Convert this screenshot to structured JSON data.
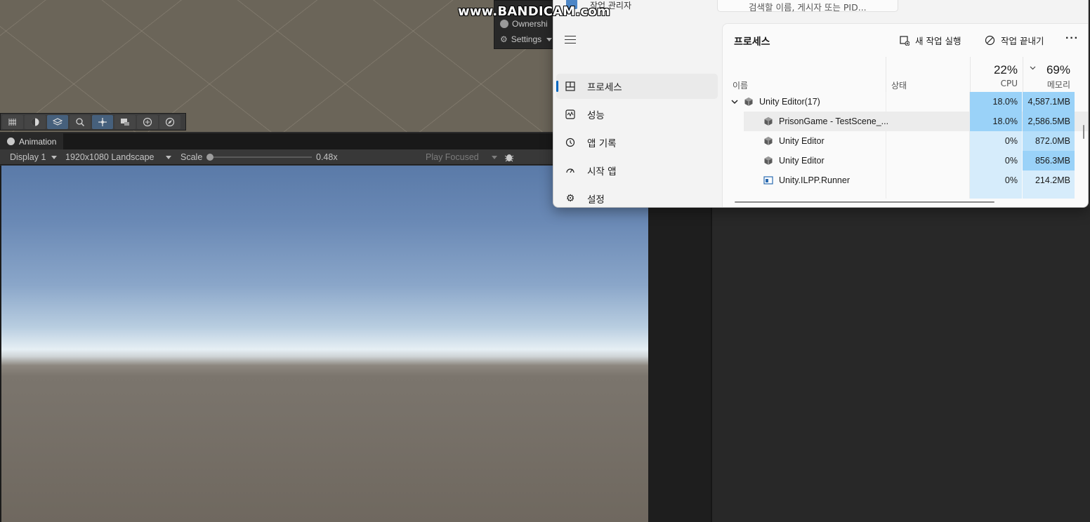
{
  "watermark": "www.BANDICAM.com",
  "netcode_panel": {
    "ownership": "Ownershi",
    "settings": "Settings"
  },
  "scene_toolbar": {
    "tools": [
      "grid-snap-icon",
      "shading-icon",
      "layers-icon",
      "search-icon",
      "move-tool-icon",
      "gizmo-icon",
      "audio-icon",
      "navigate-icon"
    ]
  },
  "game_view": {
    "tab_label": "Animation",
    "display": "Display 1",
    "resolution": "1920x1080 Landscape",
    "scale_label": "Scale",
    "scale_value": "0.48x",
    "play_mode": "Play Focused"
  },
  "task_manager": {
    "title": "작업 관리자",
    "search_placeholder": "검색할 이름, 게시자 또는 PID...",
    "nav": [
      {
        "label": "프로세스",
        "icon": "processes-icon",
        "selected": true
      },
      {
        "label": "성능",
        "icon": "performance-icon",
        "selected": false
      },
      {
        "label": "앱 기록",
        "icon": "history-icon",
        "selected": false
      },
      {
        "label": "시작 앱",
        "icon": "startup-icon",
        "selected": false
      },
      {
        "label": "설정",
        "icon": "settings-icon",
        "selected": false
      }
    ],
    "content_title": "프로세스",
    "actions": {
      "new_task": "새 작업 실행",
      "end_task": "작업 끝내기"
    },
    "columns": {
      "name": "이름",
      "status": "상태",
      "cpu_total": "22%",
      "cpu_label": "CPU",
      "mem_total": "69%",
      "mem_label": "메모리"
    },
    "rows": [
      {
        "name": "Unity Editor(17)",
        "cpu": "18.0%",
        "mem": "4,587.1MB"
      },
      {
        "name": "PrisonGame - TestScene_...",
        "cpu": "18.0%",
        "mem": "2,586.5MB"
      },
      {
        "name": "Unity Editor",
        "cpu": "0%",
        "mem": "872.0MB"
      },
      {
        "name": "Unity Editor",
        "cpu": "0%",
        "mem": "856.3MB"
      },
      {
        "name": "Unity.ILPP.Runner",
        "cpu": "0%",
        "mem": "214.2MB"
      }
    ],
    "colors": {
      "cpu_heat": "#9ad2f8",
      "mem_heat_high": "#9ad2f8",
      "mem_heat_mid": "#b6dffa",
      "mem_heat_low": "#d6ecfb",
      "accent": "#0067c0"
    }
  }
}
